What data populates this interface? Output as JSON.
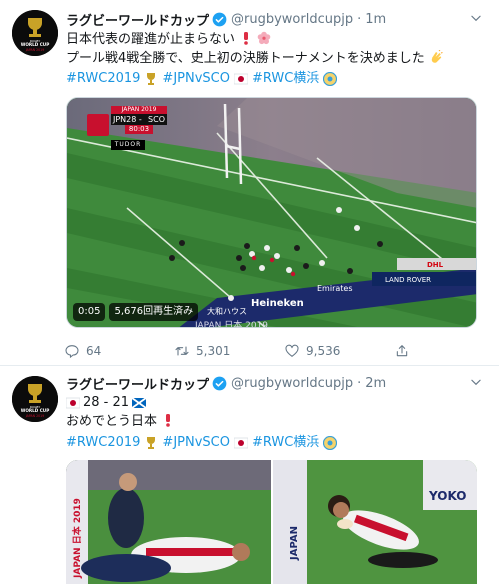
{
  "tweets": [
    {
      "name": "ラグビーワールドカップ",
      "handle": "@rugbyworldcupjp",
      "separator": "·",
      "time": "1m",
      "line1": "日本代表の躍進が止まらない",
      "line2": "プール戦4戦全勝で、史上初の決勝トーナメントを決めました",
      "hashtags": [
        "#RWC2019",
        "#JPNvSCO",
        "#RWC横浜"
      ],
      "video": {
        "duration": "0:05",
        "views": "5,676回再生済み",
        "scorebug": {
          "title": "JAPAN 2019",
          "home": "JPN",
          "score": "28 - 21",
          "away": "SCO",
          "clock": "80:03",
          "sponsor": "TUDOR"
        },
        "boards": [
          "Heineken",
          "Emirates",
          "LAND ROVER",
          "DHL",
          "大和ハウス",
          "JAPAN 日本 2019"
        ]
      },
      "actions": {
        "reply_count": "64",
        "retweet_count": "5,301",
        "like_count": "9,536"
      }
    },
    {
      "name": "ラグビーワールドカップ",
      "handle": "@rugbyworldcupjp",
      "separator": "·",
      "time": "2m",
      "score_line": "28 - 21",
      "line2": "おめでとう日本",
      "hashtags": [
        "#RWC2019",
        "#JPNvSCO",
        "#RWC横浜"
      ],
      "photo_texts": [
        "JAPAN 日本 2019",
        "JAPAN",
        "YOKO"
      ]
    }
  ],
  "colors": {
    "link": "#1b95e0",
    "muted": "#657786",
    "verified": "#1da1f2",
    "red": "#c8102e",
    "pitch": "#3f8a3c"
  },
  "icons": [
    "verified-icon",
    "caret-down-icon",
    "reply-icon",
    "retweet-icon",
    "like-icon",
    "share-icon",
    "exclamation-icon",
    "sakura-icon",
    "clap-icon",
    "flag-japan-icon",
    "flag-scotland-icon",
    "rwc-cup-icon",
    "yokohama-icon"
  ]
}
